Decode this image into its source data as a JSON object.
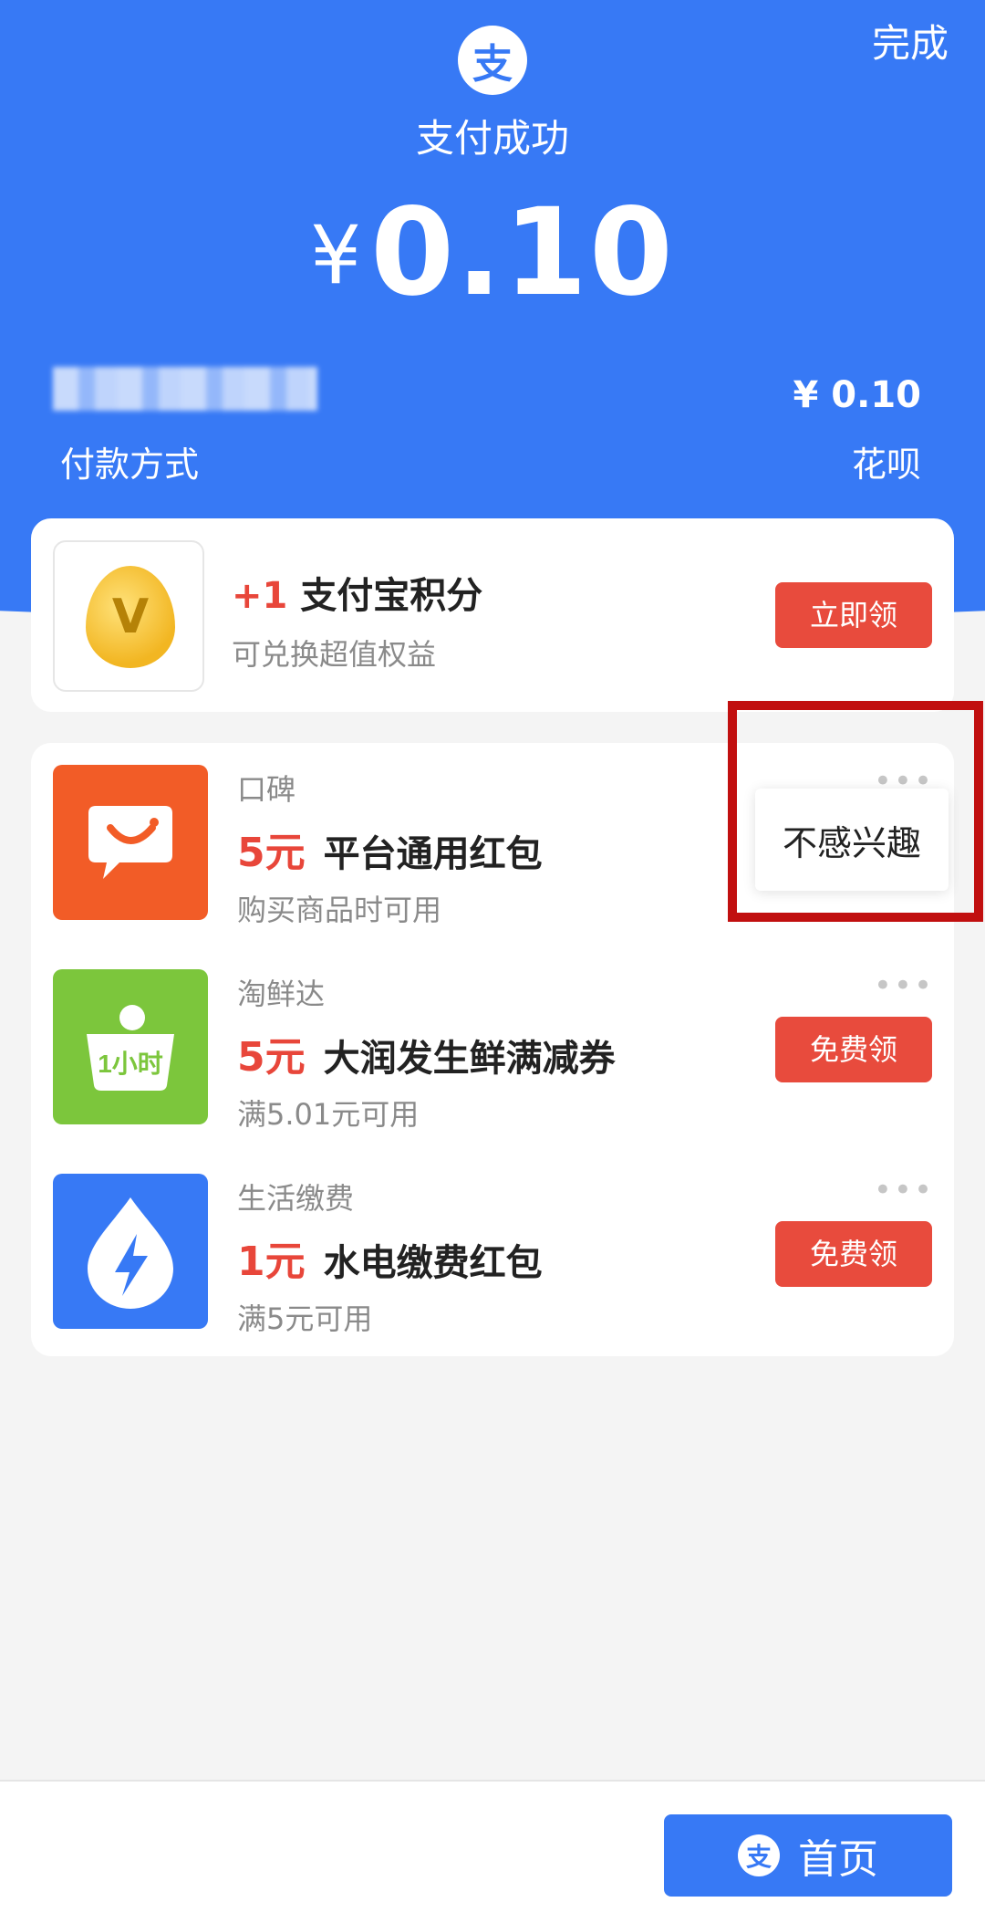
{
  "header": {
    "done_label": "完成",
    "logo_char": "支",
    "status": "支付成功",
    "currency": "¥",
    "amount": "0.10",
    "pay_amount_right": "¥ 0.10",
    "pay_method_label": "付款方式",
    "pay_method_value": "花呗"
  },
  "points_card": {
    "icon_char": "V",
    "plus": "+1",
    "title": "支付宝积分",
    "subtitle": "可兑换超值权益",
    "button": "立即领"
  },
  "offers": [
    {
      "brand": "口碑",
      "amount": "5元",
      "title": "平台通用红包",
      "condition": "购买商品时可用",
      "button": "",
      "icon_name": "koubei-icon",
      "icon_color": "#f25c27"
    },
    {
      "brand": "淘鲜达",
      "amount": "5元",
      "title": "大润发生鲜满减券",
      "condition": "满5.01元可用",
      "button": "免费领",
      "icon_name": "taoxianda-icon",
      "icon_color": "#7cc63c",
      "icon_text": "1小时"
    },
    {
      "brand": "生活缴费",
      "amount": "1元",
      "title": "水电缴费红包",
      "condition": "满5元可用",
      "button": "免费领",
      "icon_name": "utility-bill-icon",
      "icon_color": "#3779f5"
    }
  ],
  "more_dots": "•••",
  "popover_text": "不感兴趣",
  "bottom": {
    "home_label": "首页",
    "logo_char": "支"
  },
  "colors": {
    "brand_blue": "#3779f5",
    "accent_red": "#e84b3d",
    "highlight_red": "#c10f0f"
  }
}
